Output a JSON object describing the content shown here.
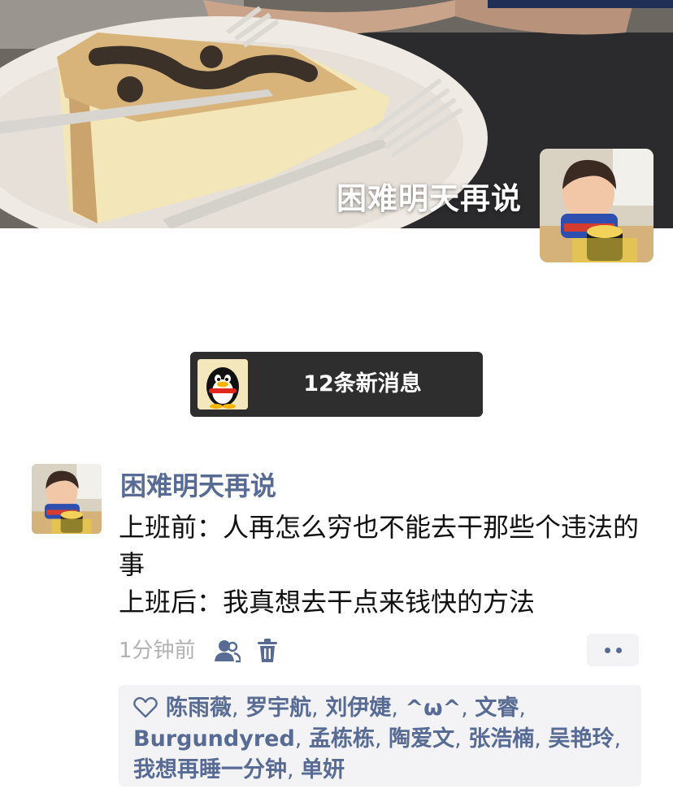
{
  "cover": {
    "username": "困难明天再说"
  },
  "new_messages": {
    "label": "12条新消息"
  },
  "post": {
    "author": "困难明天再说",
    "lines": [
      "上班前：人再怎么穷也不能去干那些个违法的事",
      "上班后：我真想去干点来钱快的方法"
    ],
    "time": "1分钟前",
    "icons": [
      "heart-icon",
      "privacy-icon",
      "delete-icon",
      "more-dots-icon"
    ],
    "likes": [
      "陈雨薇",
      "罗宇航",
      "刘伊婕",
      "^ω^",
      "文睿",
      "Burgundyred",
      "孟栋栋",
      "陶爱文",
      "张浩楠",
      "吴艳玲",
      "我想再睡一分钟",
      "单妍"
    ]
  },
  "colors": {
    "link": "#576b95",
    "text": "#111111",
    "muted": "#b2b2b2",
    "pill_bg": "#2e2e2e",
    "panel_bg": "#f3f3f5"
  }
}
